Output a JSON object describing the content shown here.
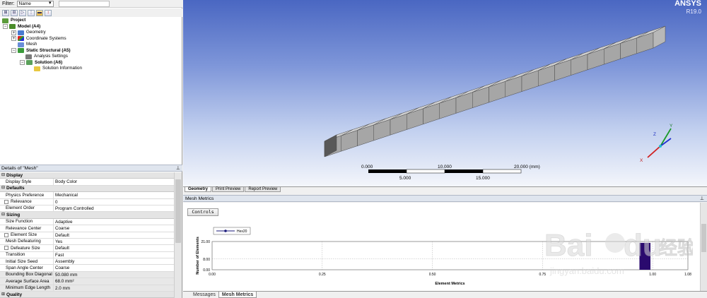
{
  "filter": {
    "label": "Filter:",
    "value": "Name"
  },
  "toolbar": {
    "icons": [
      "expand-icon",
      "collapse-icon",
      "forward-icon",
      "tree-icon",
      "folder-icon",
      "sort-icon"
    ]
  },
  "tree": {
    "project": "Project",
    "model": "Model (A4)",
    "geometry": "Geometry",
    "coordinate_systems": "Coordinate Systems",
    "mesh": "Mesh",
    "static_structural": "Static Structural (A5)",
    "analysis_settings": "Analysis Settings",
    "solution": "Solution (A6)",
    "solution_information": "Solution Information"
  },
  "details": {
    "title": "Details of \"Mesh\"",
    "sections": {
      "display": "Display",
      "defaults": "Defaults",
      "sizing": "Sizing",
      "quality": "Quality"
    },
    "rows": {
      "display_style": {
        "name": "Display Style",
        "value": "Body Color"
      },
      "physics_preference": {
        "name": "Physics Preference",
        "value": "Mechanical"
      },
      "relevance": {
        "name": "Relevance",
        "value": "0"
      },
      "element_order": {
        "name": "Element Order",
        "value": "Program Controlled"
      },
      "size_function": {
        "name": "Size Function",
        "value": "Adaptive"
      },
      "relevance_center": {
        "name": "Relevance Center",
        "value": "Coarse"
      },
      "element_size": {
        "name": "Element Size",
        "value": "Default"
      },
      "mesh_defeaturing": {
        "name": "Mesh Defeaturing",
        "value": "Yes"
      },
      "defeature_size": {
        "name": "Defeature Size",
        "value": "Default"
      },
      "transition": {
        "name": "Transition",
        "value": "Fast"
      },
      "initial_size_seed": {
        "name": "Initial Size Seed",
        "value": "Assembly"
      },
      "span_angle_center": {
        "name": "Span Angle Center",
        "value": "Coarse"
      },
      "bounding_box_diagonal": {
        "name": "Bounding Box Diagonal",
        "value": "50.080 mm"
      },
      "average_surface_area": {
        "name": "Average Surface Area",
        "value": "68.0 mm²"
      },
      "minimum_edge_length": {
        "name": "Minimum Edge Length",
        "value": "2.0 mm"
      }
    }
  },
  "viewport": {
    "brand": "ANSYS",
    "version": "R19.0",
    "beam_elements": 20,
    "scale_top": [
      "0.000",
      "10.000",
      "20.000 (mm)"
    ],
    "scale_bottom": [
      "5.000",
      "15.000"
    ],
    "triad": {
      "x": "X",
      "y": "Y",
      "z": "Z"
    }
  },
  "tabs": [
    "Geometry",
    "Print Preview",
    "Report Preview"
  ],
  "mesh_metrics": {
    "title": "Mesh Metrics",
    "controls_label": "Controls",
    "bottom_tabs": [
      "Messages",
      "Mesh Metrics"
    ]
  },
  "watermark": {
    "brand": "Bai",
    "brand2": "du",
    "cn": "经验",
    "url": "jingyan.baidu.com"
  },
  "colors": {
    "bar": "#2a0a6e",
    "legend_line": "#1a1a7a",
    "panel_header": "#dfe5ee"
  },
  "chart_data": {
    "type": "bar",
    "legend": [
      "Hex20"
    ],
    "xlabel": "Element Metrics",
    "ylabel": "Number of Elements",
    "xticks": [
      "0.00",
      "0.25",
      "0.50",
      "0.75",
      "1.00",
      "1.08"
    ],
    "yticks": [
      "0.00",
      "8.00",
      "21.00"
    ],
    "xlim": [
      0,
      1.08
    ],
    "ylim": [
      0,
      21
    ],
    "series": [
      {
        "name": "Hex20",
        "bars": [
          {
            "x0": 0.97,
            "x1": 0.995,
            "value": 20
          }
        ]
      }
    ]
  }
}
